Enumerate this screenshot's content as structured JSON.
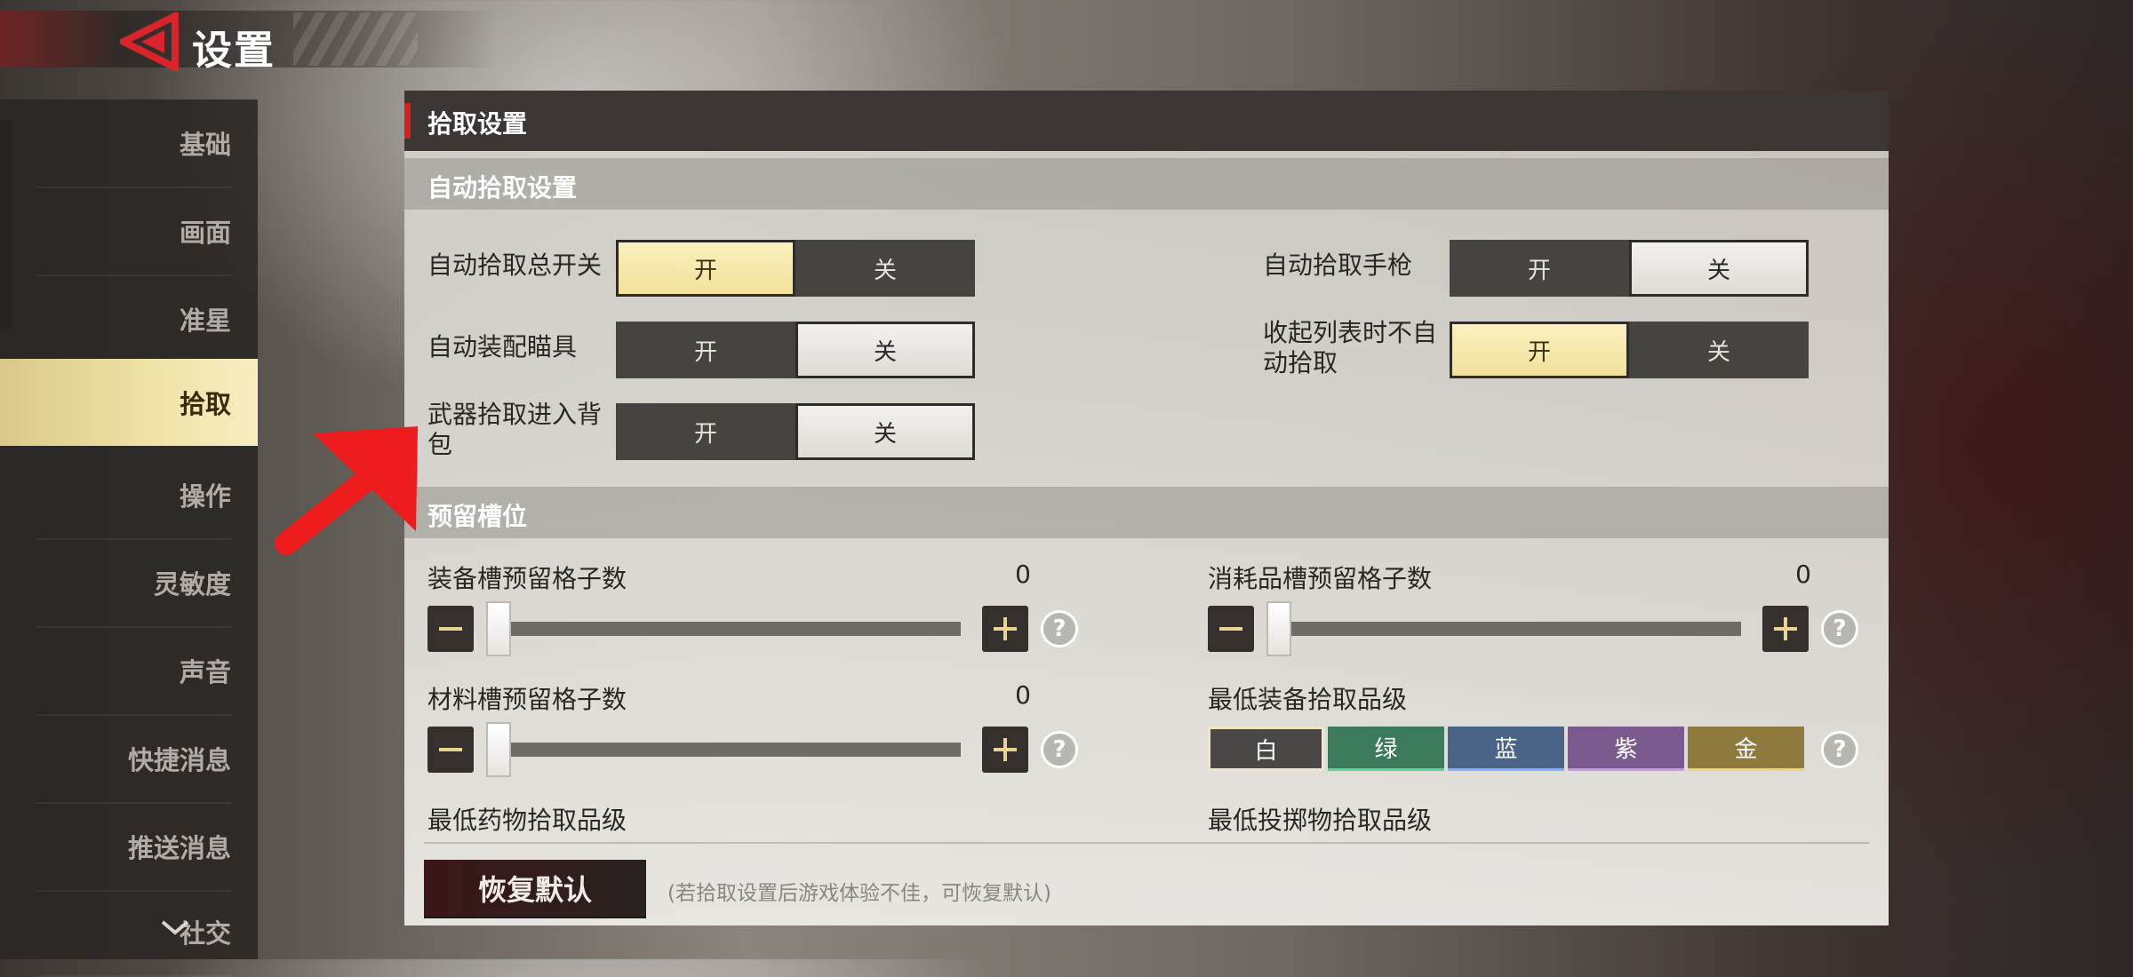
{
  "header": {
    "title": "设置"
  },
  "sidebar": {
    "items": [
      {
        "label": "基础",
        "active": false
      },
      {
        "label": "画面",
        "active": false
      },
      {
        "label": "准星",
        "active": false
      },
      {
        "label": "拾取",
        "active": true
      },
      {
        "label": "操作",
        "active": false
      },
      {
        "label": "灵敏度",
        "active": false
      },
      {
        "label": "声音",
        "active": false
      },
      {
        "label": "快捷消息",
        "active": false
      },
      {
        "label": "推送消息",
        "active": false
      },
      {
        "label": "社交",
        "active": false
      }
    ]
  },
  "panel": {
    "title": "拾取设置",
    "auto_section": "自动拾取设置",
    "toggles": [
      {
        "label": "自动拾取总开关",
        "on": "开",
        "off": "关",
        "value": "开"
      },
      {
        "label": "自动拾取手枪",
        "on": "开",
        "off": "关",
        "value": "关"
      },
      {
        "label": "自动装配瞄具",
        "on": "开",
        "off": "关",
        "value": "关"
      },
      {
        "label": "收起列表时不自动拾取",
        "on": "开",
        "off": "关",
        "value": "开"
      },
      {
        "label": "武器拾取进入背包",
        "on": "开",
        "off": "关",
        "value": "关"
      }
    ],
    "reserve_section": "预留槽位",
    "sliders": [
      {
        "label": "装备槽预留格子数",
        "value": "0"
      },
      {
        "label": "消耗品槽预留格子数",
        "value": "0"
      },
      {
        "label": "材料槽预留格子数",
        "value": "0"
      }
    ],
    "quality": {
      "label": "最低装备拾取品级",
      "options": [
        "白",
        "绿",
        "蓝",
        "紫",
        "金"
      ],
      "selected": "白",
      "colors": [
        "#4a4746",
        "#3b7a5a",
        "#4a6488",
        "#7a5a8e",
        "#8f7a3e"
      ]
    },
    "med_quality_label": "最低药物拾取品级",
    "throw_quality_label": "最低投掷物拾取品级",
    "reset": {
      "label": "恢复默认",
      "hint": "(若拾取设置后游戏体验不佳，可恢复默认)"
    },
    "help_glyph": "?"
  },
  "colors": {
    "accent_red": "#d81e1e",
    "active_gold": "#f2e19b"
  }
}
